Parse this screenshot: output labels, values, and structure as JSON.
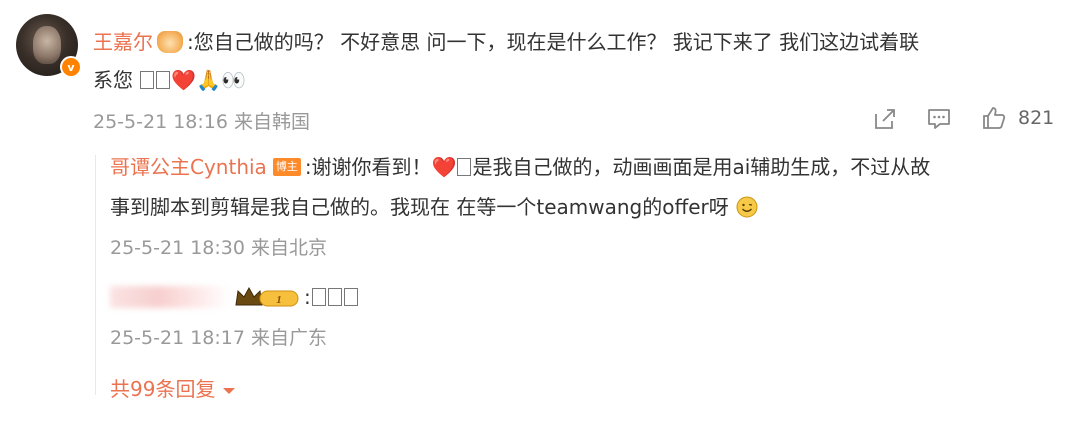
{
  "comment": {
    "username": "王嘉尔",
    "text_line1": ":您自己做的吗？  不好意思 问一下，现在是什么工作？  我记下来了 我们这边试着联",
    "text_line2": "系您",
    "emoji_tail": "❤️🙏👀",
    "time": "25-5-21 18:16 来自韩国",
    "like_count": "821"
  },
  "replies": [
    {
      "username": "哥谭公主Cynthia",
      "badge": "博主",
      "text_line1": ":谢谢你看到！",
      "text_line1b": "是我自己做的，动画画面是用ai辅助生成，不过从故",
      "text_line2": "事到脚本到剪辑是我自己做的。我现在 在等一个teamwang的offer呀",
      "time": "25-5-21 18:30 来自北京"
    },
    {
      "username_hidden": true,
      "level_badge": "1",
      "text": ":",
      "time": "25-5-21 18:17 来自广东"
    }
  ],
  "more_replies": "共99条回复"
}
